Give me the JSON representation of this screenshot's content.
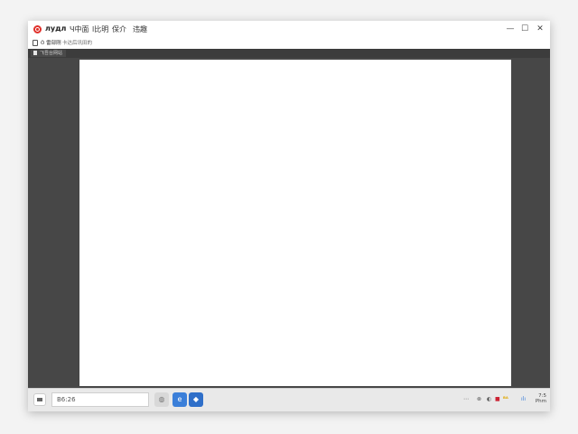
{
  "window": {
    "title": "лудл",
    "menus": [
      "Ч中面",
      "l比明",
      "保介",
      "违趣"
    ],
    "controls": {
      "minimize": "—",
      "maximize": "☐",
      "close": "✕"
    }
  },
  "toolbar": {
    "item1": "Ȍ 雷部刚",
    "item2": "卡达后讯田的"
  },
  "tabs": [
    {
      "label": "飞吾台网站",
      "close": "⊡"
    }
  ],
  "taskbar": {
    "search_text": "B6:26",
    "apps": [
      {
        "name": "chat-app",
        "glyph": "◍"
      },
      {
        "name": "browser-app",
        "glyph": "e"
      },
      {
        "name": "store-app",
        "glyph": "◆"
      }
    ],
    "tray": [
      "⋯",
      "⊗",
      "◐",
      "■",
      "ᴮᴬ",
      "ılı"
    ],
    "clock_time": "7:5",
    "clock_date": "Phm"
  },
  "colors": {
    "workspace": "#474747",
    "accent": "#3b7fd9",
    "logo": "#e0302a"
  }
}
